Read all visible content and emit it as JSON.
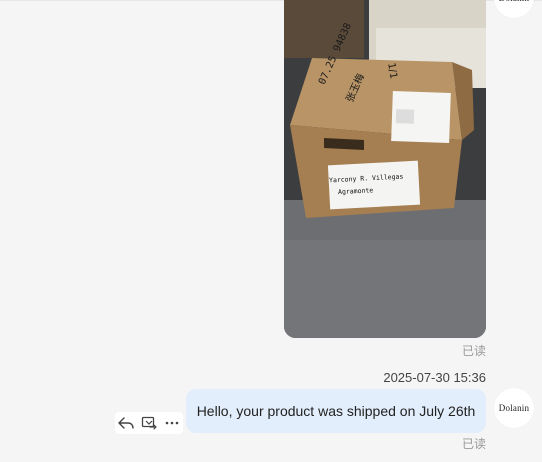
{
  "messages": [
    {
      "type": "image",
      "status": "已读",
      "image_labels": {
        "box_marker_text": "07.25 94838",
        "box_marker_text2": "张玉梅",
        "box_side_text": "1/1",
        "shipping_label_line1": "Yarcony R. Villegas",
        "shipping_label_line2": "Agramonte"
      }
    },
    {
      "type": "text",
      "timestamp": "2025-07-30 15:36",
      "text": "Hello, your product was shipped on July 26th",
      "status": "已读"
    }
  ],
  "avatar": {
    "label": "Dolanin"
  },
  "actions": [
    {
      "name": "reply-icon"
    },
    {
      "name": "forward-icon"
    },
    {
      "name": "more-icon"
    }
  ]
}
